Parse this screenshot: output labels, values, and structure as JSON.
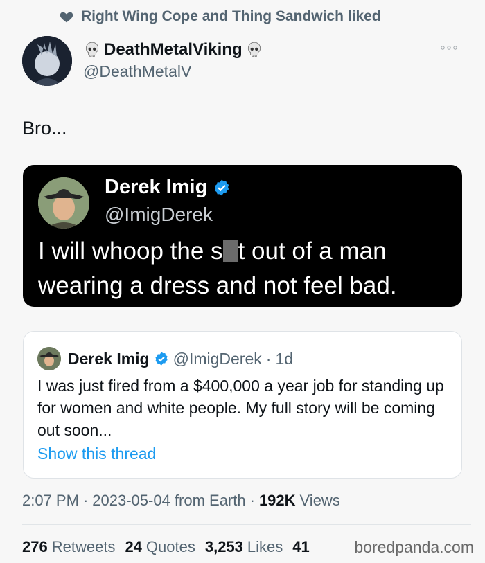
{
  "social_context": {
    "text": "Right Wing Cope and Thing Sandwich liked",
    "icon": "heart-icon"
  },
  "author": {
    "name": "DeathMetalViking",
    "handle": "@DeathMetalV",
    "name_icon": "skull-icon"
  },
  "tweet": {
    "text": "Bro..."
  },
  "embedded_tweet": {
    "name": "Derek Imig",
    "handle": "@ImigDerek",
    "text_before": "I will whoop the s",
    "text_after": "t out of a man wearing a dress and not feel bad."
  },
  "quoted_tweet": {
    "name": "Derek Imig",
    "handle": "@ImigDerek",
    "separator": "·",
    "time": "1d",
    "text": "I was just fired from a $400,000 a year job for standing up for women and white people.  My full story will be coming out soon...",
    "show_thread": "Show this thread"
  },
  "meta": {
    "time": "2:07 PM",
    "sep1": "·",
    "date": "2023-05-04 from Earth",
    "sep2": "·",
    "views_count": "192K",
    "views_label": "Views"
  },
  "stats": {
    "retweets_count": "276",
    "retweets_label": "Retweets",
    "quotes_count": "24",
    "quotes_label": "Quotes",
    "likes_count": "3,253",
    "likes_label": "Likes",
    "bookmarks_count": "41"
  },
  "watermark": "boredpanda.com",
  "colors": {
    "link": "#1d9bf0",
    "verified": "#1d9bf0",
    "secondary_text": "#536471"
  }
}
